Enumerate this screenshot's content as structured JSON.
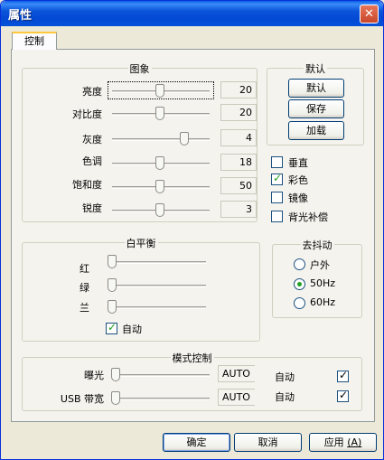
{
  "window": {
    "title": "属性",
    "close_glyph": "✕"
  },
  "tab": {
    "label": "控制"
  },
  "image_group": {
    "title": "图象",
    "rows": [
      {
        "label": "亮度",
        "value": "20",
        "position": 0.5
      },
      {
        "label": "对比度",
        "value": "20",
        "position": 0.5
      },
      {
        "label": "灰度",
        "value": "4",
        "position": 0.75
      },
      {
        "label": "色调",
        "value": "18",
        "position": 0.5
      },
      {
        "label": "饱和度",
        "value": "50",
        "position": 0.5
      },
      {
        "label": "锐度",
        "value": "3",
        "position": 0.5
      }
    ]
  },
  "defaults_group": {
    "title": "默认",
    "default_label": "默认",
    "save_label": "保存",
    "load_label": "加载"
  },
  "image_options": [
    {
      "label": "垂直",
      "checked": false
    },
    {
      "label": "彩色",
      "checked": true
    },
    {
      "label": "镜像",
      "checked": false
    },
    {
      "label": "背光补偿",
      "checked": false
    }
  ],
  "white_balance": {
    "title": "白平衡",
    "rows": [
      {
        "label": "红",
        "position": 0.0
      },
      {
        "label": "绿",
        "position": 0.0
      },
      {
        "label": "兰",
        "position": 0.0
      }
    ],
    "auto_label": "自动",
    "auto_checked": true
  },
  "anti_flicker": {
    "title": "去抖动",
    "options": [
      {
        "label": "户外",
        "selected": false
      },
      {
        "label": "50Hz",
        "selected": true
      },
      {
        "label": "60Hz",
        "selected": false
      }
    ]
  },
  "mode_control": {
    "title": "模式控制",
    "rows": [
      {
        "label": "曝光",
        "value": "AUTO",
        "auto_label": "自动",
        "auto_checked": true,
        "position": 0.0
      },
      {
        "label": "USB 带宽",
        "value": "AUTO",
        "auto_label": "自动",
        "auto_checked": true,
        "position": 0.0
      }
    ]
  },
  "footer": {
    "ok_label": "确定",
    "cancel_label": "取消",
    "apply_label": "应用",
    "apply_accel": "(A)"
  },
  "colors": {
    "title_bar": "#0a54d9",
    "check_mark": "#21a121",
    "window_bg": "#ece9d8"
  }
}
